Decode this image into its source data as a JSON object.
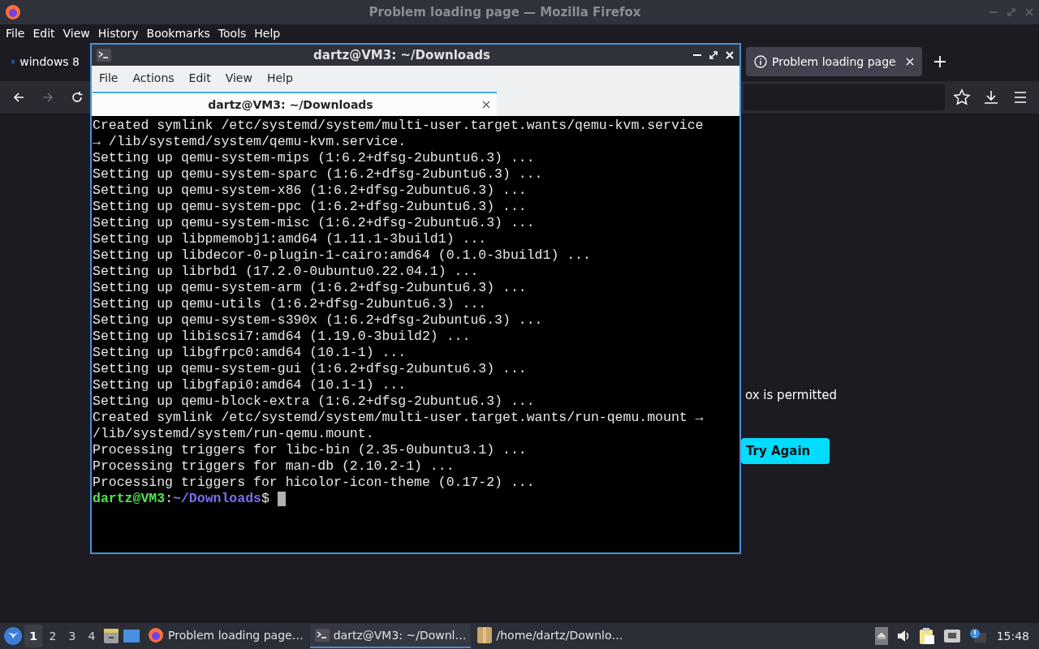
{
  "firefox": {
    "title": "Problem loading page — Mozilla Firefox",
    "menu": [
      "File",
      "Edit",
      "View",
      "History",
      "Bookmarks",
      "Tools",
      "Help"
    ],
    "tabs": [
      {
        "label": "windows 8",
        "selected": false
      },
      {
        "label": "Problem loading page",
        "selected": true
      }
    ],
    "nav_buttons": [
      {
        "kind": "back",
        "disabled": false
      },
      {
        "kind": "forward",
        "disabled": true
      },
      {
        "kind": "reload",
        "disabled": false
      }
    ],
    "page": {
      "message": "ox is permitted",
      "button": "Try Again"
    }
  },
  "terminal": {
    "title": "dartz@VM3: ~/Downloads",
    "menu": [
      "File",
      "Actions",
      "Edit",
      "View",
      "Help"
    ],
    "tabs": [
      {
        "label": "dartz@VM3: ~/Downloads",
        "selected": true
      }
    ],
    "lines": [
      "Created symlink /etc/systemd/system/multi-user.target.wants/qemu-kvm.service",
      "→ /lib/systemd/system/qemu-kvm.service.",
      "Setting up qemu-system-mips (1:6.2+dfsg-2ubuntu6.3) ...",
      "Setting up qemu-system-sparc (1:6.2+dfsg-2ubuntu6.3) ...",
      "Setting up qemu-system-x86 (1:6.2+dfsg-2ubuntu6.3) ...",
      "Setting up qemu-system-ppc (1:6.2+dfsg-2ubuntu6.3) ...",
      "Setting up qemu-system-misc (1:6.2+dfsg-2ubuntu6.3) ...",
      "Setting up libpmemobj1:amd64 (1.11.1-3build1) ...",
      "Setting up libdecor-0-plugin-1-cairo:amd64 (0.1.0-3build1) ...",
      "Setting up librbd1 (17.2.0-0ubuntu0.22.04.1) ...",
      "Setting up qemu-system-arm (1:6.2+dfsg-2ubuntu6.3) ...",
      "Setting up qemu-utils (1:6.2+dfsg-2ubuntu6.3) ...",
      "Setting up qemu-system-s390x (1:6.2+dfsg-2ubuntu6.3) ...",
      "Setting up libiscsi7:amd64 (1.19.0-3build2) ...",
      "Setting up libgfrpc0:amd64 (10.1-1) ...",
      "Setting up qemu-system-gui (1:6.2+dfsg-2ubuntu6.3) ...",
      "Setting up libgfapi0:amd64 (10.1-1) ...",
      "Setting up qemu-block-extra (1:6.2+dfsg-2ubuntu6.3) ...",
      "Created symlink /etc/systemd/system/multi-user.target.wants/run-qemu.mount →",
      "/lib/systemd/system/run-qemu.mount.",
      "Processing triggers for libc-bin (2.35-0ubuntu3.1) ...",
      "Processing triggers for man-db (2.10.2-1) ...",
      "Processing triggers for hicolor-icon-theme (0.17-2) ..."
    ],
    "prompt": [
      {
        "kind": "user",
        "text": "dartz@VM3"
      },
      {
        "kind": "plain",
        "text": ":"
      },
      {
        "kind": "path",
        "text": "~/Downloads"
      },
      {
        "kind": "plain",
        "text": "$"
      }
    ]
  },
  "taskbar": {
    "workspaces": [
      {
        "label": "1",
        "selected": true
      },
      {
        "label": "2",
        "selected": false
      },
      {
        "label": "3",
        "selected": false
      },
      {
        "label": "4",
        "selected": false
      }
    ],
    "tasks": [
      {
        "kind": "firefox",
        "label": "Problem loading page…",
        "selected": false
      },
      {
        "kind": "terminal",
        "label": "dartz@VM3: ~/Downl…",
        "selected": true
      },
      {
        "kind": "folder",
        "label": "/home/dartz/Downlo…",
        "selected": false
      }
    ],
    "clock": "15:48"
  }
}
